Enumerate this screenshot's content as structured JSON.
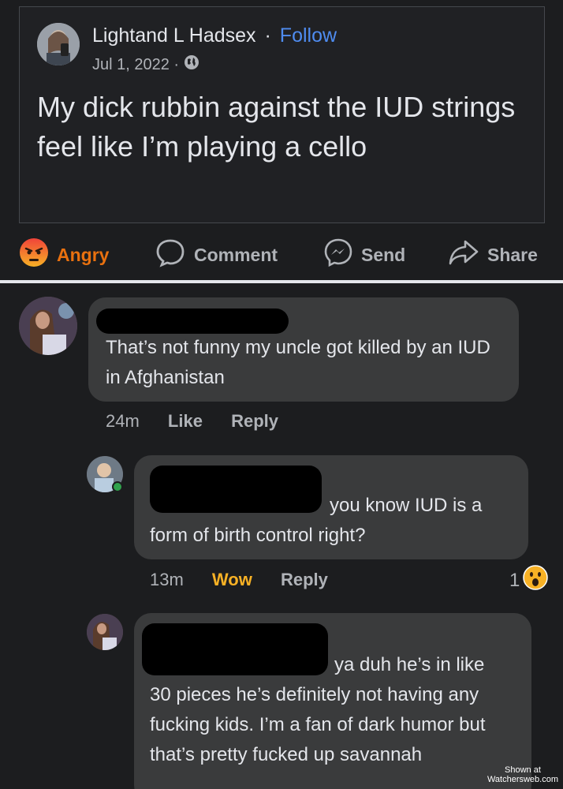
{
  "post": {
    "author": "Lightand L Hadsex",
    "separator": "·",
    "follow": "Follow",
    "date": "Jul 1, 2022 ·",
    "privacy_icon": "globe-icon",
    "text": "My dick rubbin against the IUD strings feel like I’m playing a cello"
  },
  "actions": {
    "reaction": "Angry",
    "comment": "Comment",
    "send": "Send",
    "share": "Share"
  },
  "comments": [
    {
      "text": "That’s not funny my uncle got killed by an IUD in Afghanistan",
      "time": "24m",
      "like": "Like",
      "reply": "Reply"
    },
    {
      "text_line1": "you know IUD is a",
      "text_line2": "form of birth control right?",
      "time": "13m",
      "reaction": "Wow",
      "reply": "Reply",
      "reaction_count": "1"
    },
    {
      "text_line1": "ya duh he’s in like",
      "text_rest": "30 pieces he’s definitely not having any fucking kids. I’m a fan of dark humor but that’s pretty fucked up savannah"
    }
  ],
  "watermark": {
    "line1": "Shown at",
    "line2": "Watchersweb.com"
  },
  "colors": {
    "background": "#1c1d1f",
    "bubble": "#3a3b3c",
    "follow": "#4f8cf0",
    "angry": "#e9710f",
    "wow": "#f7b125"
  }
}
